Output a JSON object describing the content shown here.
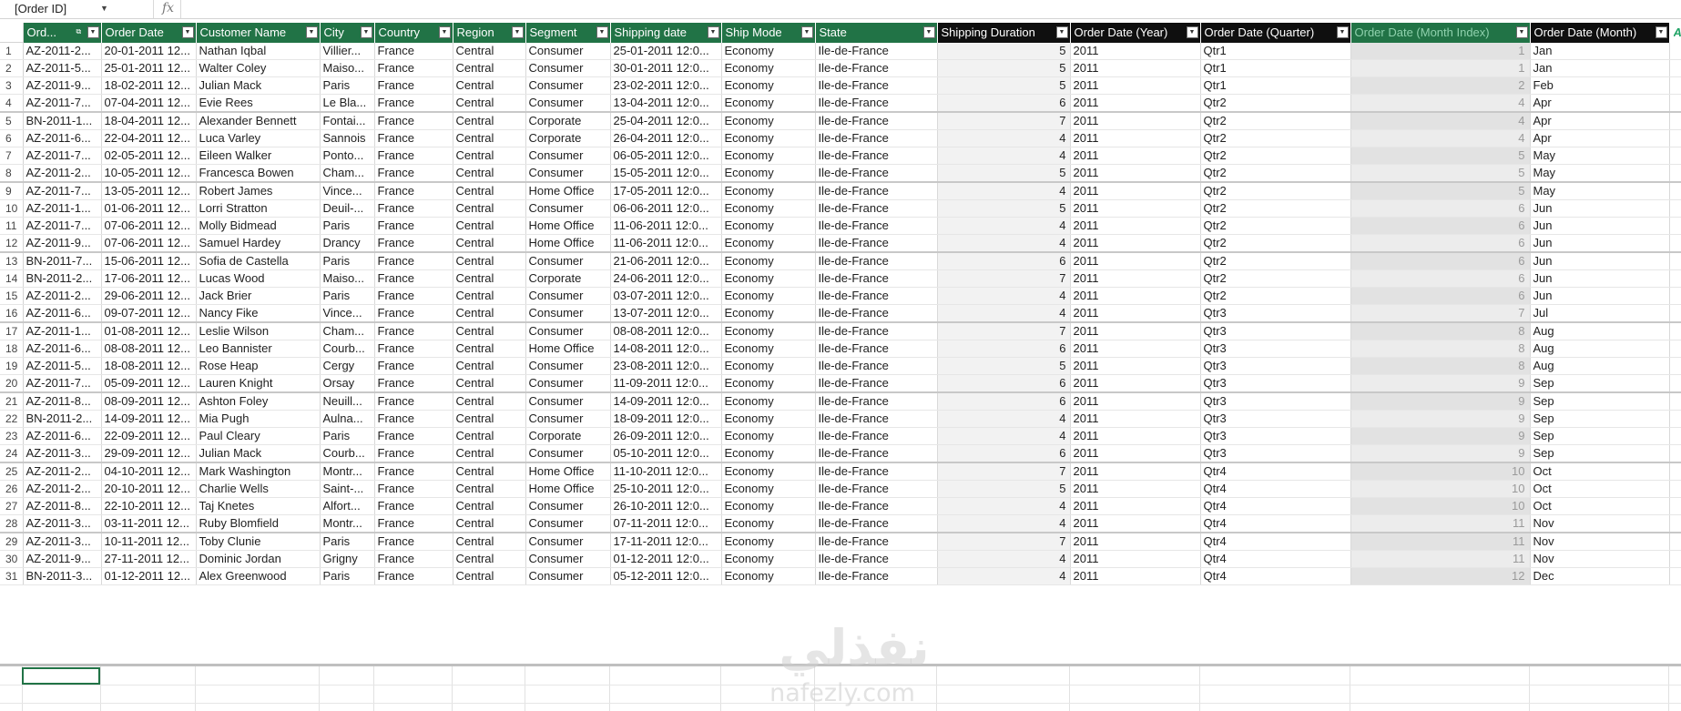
{
  "formula_bar": {
    "name_box": "[Order ID]",
    "fx": "fx",
    "formula": ""
  },
  "columns": [
    {
      "label": "Ord...",
      "dark": false
    },
    {
      "label": "Order Date",
      "dark": false
    },
    {
      "label": "Customer Name",
      "dark": false
    },
    {
      "label": "City",
      "dark": false
    },
    {
      "label": "Country",
      "dark": false
    },
    {
      "label": "Region",
      "dark": false
    },
    {
      "label": "Segment",
      "dark": false
    },
    {
      "label": "Shipping date",
      "dark": false
    },
    {
      "label": "Ship Mode",
      "dark": false
    },
    {
      "label": "State",
      "dark": false
    },
    {
      "label": "Shipping Duration",
      "dark": true
    },
    {
      "label": "Order Date (Year)",
      "dark": true
    },
    {
      "label": "Order Date (Quarter)",
      "dark": true
    },
    {
      "label": "Order Date (Month Index)",
      "dark": false
    },
    {
      "label": "Order Date (Month)",
      "dark": true
    }
  ],
  "add_column_label": "Add",
  "rows": [
    [
      "AZ-2011-2...",
      "20-01-2011 12...",
      "Nathan Iqbal",
      "Villier...",
      "France",
      "Central",
      "Consumer",
      "25-01-2011 12:0...",
      "Economy",
      "Ile-de-France",
      "5",
      "2011",
      "Qtr1",
      "1",
      "Jan"
    ],
    [
      "AZ-2011-5...",
      "25-01-2011 12...",
      "Walter Coley",
      "Maiso...",
      "France",
      "Central",
      "Consumer",
      "30-01-2011 12:0...",
      "Economy",
      "Ile-de-France",
      "5",
      "2011",
      "Qtr1",
      "1",
      "Jan"
    ],
    [
      "AZ-2011-9...",
      "18-02-2011 12...",
      "Julian Mack",
      "Paris",
      "France",
      "Central",
      "Consumer",
      "23-02-2011 12:0...",
      "Economy",
      "Ile-de-France",
      "5",
      "2011",
      "Qtr1",
      "2",
      "Feb"
    ],
    [
      "AZ-2011-7...",
      "07-04-2011 12...",
      "Evie Rees",
      "Le Bla...",
      "France",
      "Central",
      "Consumer",
      "13-04-2011 12:0...",
      "Economy",
      "Ile-de-France",
      "6",
      "2011",
      "Qtr2",
      "4",
      "Apr"
    ],
    [
      "BN-2011-1...",
      "18-04-2011 12...",
      "Alexander Bennett",
      "Fontai...",
      "France",
      "Central",
      "Corporate",
      "25-04-2011 12:0...",
      "Economy",
      "Ile-de-France",
      "7",
      "2011",
      "Qtr2",
      "4",
      "Apr"
    ],
    [
      "AZ-2011-6...",
      "22-04-2011 12...",
      "Luca Varley",
      "Sannois",
      "France",
      "Central",
      "Corporate",
      "26-04-2011 12:0...",
      "Economy",
      "Ile-de-France",
      "4",
      "2011",
      "Qtr2",
      "4",
      "Apr"
    ],
    [
      "AZ-2011-7...",
      "02-05-2011 12...",
      "Eileen Walker",
      "Ponto...",
      "France",
      "Central",
      "Consumer",
      "06-05-2011 12:0...",
      "Economy",
      "Ile-de-France",
      "4",
      "2011",
      "Qtr2",
      "5",
      "May"
    ],
    [
      "AZ-2011-2...",
      "10-05-2011 12...",
      "Francesca Bowen",
      "Cham...",
      "France",
      "Central",
      "Consumer",
      "15-05-2011 12:0...",
      "Economy",
      "Ile-de-France",
      "5",
      "2011",
      "Qtr2",
      "5",
      "May"
    ],
    [
      "AZ-2011-7...",
      "13-05-2011 12...",
      "Robert James",
      "Vince...",
      "France",
      "Central",
      "Home Office",
      "17-05-2011 12:0...",
      "Economy",
      "Ile-de-France",
      "4",
      "2011",
      "Qtr2",
      "5",
      "May"
    ],
    [
      "AZ-2011-1...",
      "01-06-2011 12...",
      "Lorri Stratton",
      "Deuil-...",
      "France",
      "Central",
      "Consumer",
      "06-06-2011 12:0...",
      "Economy",
      "Ile-de-France",
      "5",
      "2011",
      "Qtr2",
      "6",
      "Jun"
    ],
    [
      "AZ-2011-7...",
      "07-06-2011 12...",
      "Molly Bidmead",
      "Paris",
      "France",
      "Central",
      "Home Office",
      "11-06-2011 12:0...",
      "Economy",
      "Ile-de-France",
      "4",
      "2011",
      "Qtr2",
      "6",
      "Jun"
    ],
    [
      "AZ-2011-9...",
      "07-06-2011 12...",
      "Samuel Hardey",
      "Drancy",
      "France",
      "Central",
      "Home Office",
      "11-06-2011 12:0...",
      "Economy",
      "Ile-de-France",
      "4",
      "2011",
      "Qtr2",
      "6",
      "Jun"
    ],
    [
      "BN-2011-7...",
      "15-06-2011 12...",
      "Sofia de Castella",
      "Paris",
      "France",
      "Central",
      "Consumer",
      "21-06-2011 12:0...",
      "Economy",
      "Ile-de-France",
      "6",
      "2011",
      "Qtr2",
      "6",
      "Jun"
    ],
    [
      "BN-2011-2...",
      "17-06-2011 12...",
      "Lucas Wood",
      "Maiso...",
      "France",
      "Central",
      "Corporate",
      "24-06-2011 12:0...",
      "Economy",
      "Ile-de-France",
      "7",
      "2011",
      "Qtr2",
      "6",
      "Jun"
    ],
    [
      "AZ-2011-2...",
      "29-06-2011 12...",
      "Jack Brier",
      "Paris",
      "France",
      "Central",
      "Consumer",
      "03-07-2011 12:0...",
      "Economy",
      "Ile-de-France",
      "4",
      "2011",
      "Qtr2",
      "6",
      "Jun"
    ],
    [
      "AZ-2011-6...",
      "09-07-2011 12...",
      "Nancy Fike",
      "Vince...",
      "France",
      "Central",
      "Consumer",
      "13-07-2011 12:0...",
      "Economy",
      "Ile-de-France",
      "4",
      "2011",
      "Qtr3",
      "7",
      "Jul"
    ],
    [
      "AZ-2011-1...",
      "01-08-2011 12...",
      "Leslie Wilson",
      "Cham...",
      "France",
      "Central",
      "Consumer",
      "08-08-2011 12:0...",
      "Economy",
      "Ile-de-France",
      "7",
      "2011",
      "Qtr3",
      "8",
      "Aug"
    ],
    [
      "AZ-2011-6...",
      "08-08-2011 12...",
      "Leo Bannister",
      "Courb...",
      "France",
      "Central",
      "Home Office",
      "14-08-2011 12:0...",
      "Economy",
      "Ile-de-France",
      "6",
      "2011",
      "Qtr3",
      "8",
      "Aug"
    ],
    [
      "AZ-2011-5...",
      "18-08-2011 12...",
      "Rose Heap",
      "Cergy",
      "France",
      "Central",
      "Consumer",
      "23-08-2011 12:0...",
      "Economy",
      "Ile-de-France",
      "5",
      "2011",
      "Qtr3",
      "8",
      "Aug"
    ],
    [
      "AZ-2011-7...",
      "05-09-2011 12...",
      "Lauren Knight",
      "Orsay",
      "France",
      "Central",
      "Consumer",
      "11-09-2011 12:0...",
      "Economy",
      "Ile-de-France",
      "6",
      "2011",
      "Qtr3",
      "9",
      "Sep"
    ],
    [
      "AZ-2011-8...",
      "08-09-2011 12...",
      "Ashton Foley",
      "Neuill...",
      "France",
      "Central",
      "Consumer",
      "14-09-2011 12:0...",
      "Economy",
      "Ile-de-France",
      "6",
      "2011",
      "Qtr3",
      "9",
      "Sep"
    ],
    [
      "BN-2011-2...",
      "14-09-2011 12...",
      "Mia Pugh",
      "Aulna...",
      "France",
      "Central",
      "Consumer",
      "18-09-2011 12:0...",
      "Economy",
      "Ile-de-France",
      "4",
      "2011",
      "Qtr3",
      "9",
      "Sep"
    ],
    [
      "AZ-2011-6...",
      "22-09-2011 12...",
      "Paul Cleary",
      "Paris",
      "France",
      "Central",
      "Corporate",
      "26-09-2011 12:0...",
      "Economy",
      "Ile-de-France",
      "4",
      "2011",
      "Qtr3",
      "9",
      "Sep"
    ],
    [
      "AZ-2011-3...",
      "29-09-2011 12...",
      "Julian Mack",
      "Courb...",
      "France",
      "Central",
      "Consumer",
      "05-10-2011 12:0...",
      "Economy",
      "Ile-de-France",
      "6",
      "2011",
      "Qtr3",
      "9",
      "Sep"
    ],
    [
      "AZ-2011-2...",
      "04-10-2011 12...",
      "Mark Washington",
      "Montr...",
      "France",
      "Central",
      "Home Office",
      "11-10-2011 12:0...",
      "Economy",
      "Ile-de-France",
      "7",
      "2011",
      "Qtr4",
      "10",
      "Oct"
    ],
    [
      "AZ-2011-2...",
      "20-10-2011 12...",
      "Charlie Wells",
      "Saint-...",
      "France",
      "Central",
      "Home Office",
      "25-10-2011 12:0...",
      "Economy",
      "Ile-de-France",
      "5",
      "2011",
      "Qtr4",
      "10",
      "Oct"
    ],
    [
      "AZ-2011-8...",
      "22-10-2011 12...",
      "Taj Knetes",
      "Alfort...",
      "France",
      "Central",
      "Consumer",
      "26-10-2011 12:0...",
      "Economy",
      "Ile-de-France",
      "4",
      "2011",
      "Qtr4",
      "10",
      "Oct"
    ],
    [
      "AZ-2011-3...",
      "03-11-2011 12...",
      "Ruby Blomfield",
      "Montr...",
      "France",
      "Central",
      "Consumer",
      "07-11-2011 12:0...",
      "Economy",
      "Ile-de-France",
      "4",
      "2011",
      "Qtr4",
      "11",
      "Nov"
    ],
    [
      "AZ-2011-3...",
      "10-11-2011 12...",
      "Toby Clunie",
      "Paris",
      "France",
      "Central",
      "Consumer",
      "17-11-2011 12:0...",
      "Economy",
      "Ile-de-France",
      "7",
      "2011",
      "Qtr4",
      "11",
      "Nov"
    ],
    [
      "AZ-2011-9...",
      "27-11-2011 12...",
      "Dominic Jordan",
      "Grigny",
      "France",
      "Central",
      "Consumer",
      "01-12-2011 12:0...",
      "Economy",
      "Ile-de-France",
      "4",
      "2011",
      "Qtr4",
      "11",
      "Nov"
    ],
    [
      "BN-2011-3...",
      "01-12-2011 12...",
      "Alex Greenwood",
      "Paris",
      "France",
      "Central",
      "Consumer",
      "05-12-2011 12:0...",
      "Economy",
      "Ile-de-France",
      "4",
      "2011",
      "Qtr4",
      "12",
      "Dec"
    ]
  ],
  "separator_after_rows": [
    4,
    8,
    12,
    16,
    20,
    24,
    28
  ],
  "watermark": {
    "arabic": "نفذلي",
    "latin": "nafezly.com"
  },
  "colors": {
    "header_green": "#217346",
    "header_dark": "#0f0f0f",
    "selection": "#217346"
  }
}
